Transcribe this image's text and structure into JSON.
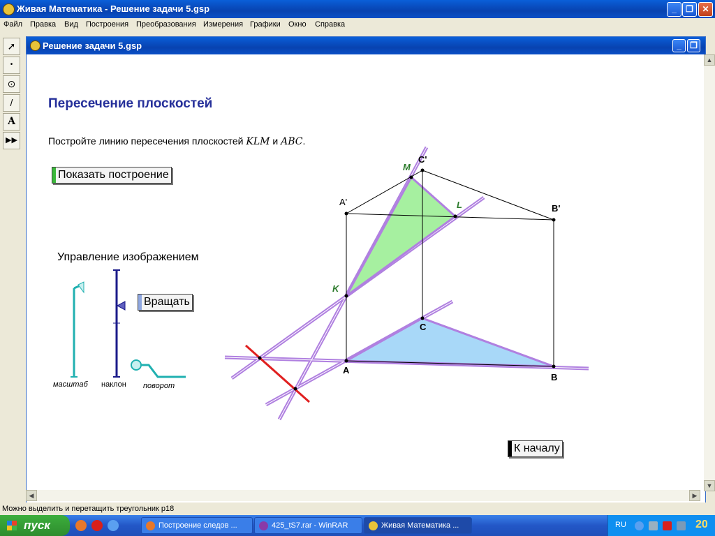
{
  "app": {
    "title": "Живая Математика - Решение задачи 5.gsp",
    "window_buttons": [
      "_",
      "❐",
      "✕"
    ]
  },
  "menu": [
    "Файл",
    "Правка",
    "Вид",
    "Построения",
    "Преобразования",
    "Измерения",
    "Графики",
    "Окно",
    "Справка"
  ],
  "toolbox": [
    {
      "name": "arrow-tool-icon",
      "glyph": "➚"
    },
    {
      "name": "point-tool-icon",
      "glyph": "•"
    },
    {
      "name": "compass-tool-icon",
      "glyph": "⊙"
    },
    {
      "name": "line-tool-icon",
      "glyph": "/"
    },
    {
      "name": "text-tool-icon",
      "glyph": "A"
    },
    {
      "name": "custom-tool-icon",
      "glyph": "▶▶"
    }
  ],
  "document": {
    "title": "Решение задачи 5.gsp",
    "heading": "Пересечение плоскостей",
    "task_prefix": "Постройте линию пересечения плоскостей",
    "task_plane1": "KLM",
    "task_and": "и",
    "task_plane2": "ABC",
    "task_dot": ".",
    "show_button": "Показать построение",
    "control_title": "Управление изображением",
    "rotate_button": "Вращать",
    "back_button": "К началу",
    "slider_labels": {
      "scale": "масштаб",
      "tilt": "наклон",
      "rotation": "поворот"
    },
    "points": {
      "A": "A",
      "B": "B",
      "C": "C",
      "A1": "A'",
      "B1": "B'",
      "C1": "C'",
      "K": "K",
      "L": "L",
      "M": "M"
    },
    "colors": {
      "title": "#26309a",
      "point_label_green": "#2a7a2a",
      "triangle_klm": "#a6f0a0",
      "triangle_abc": "#a8d8f8",
      "trace_lines": "#b080e0",
      "red_line": "#e02020",
      "slider": "#20b0b0",
      "slider_tilt": "#1a1a8a",
      "show_button_mark": "#3ab83a",
      "rotate_button_mark": "#90a8e0",
      "back_button_mark": "#000000"
    }
  },
  "status": "Можно выделить и перетащить треугольник p18",
  "taskbar": {
    "start": "пуск",
    "tasks": [
      {
        "label": "Построение следов ...",
        "active": false
      },
      {
        "label": "425_tS7.rar - WinRAR",
        "active": false
      },
      {
        "label": "Живая Математика ...",
        "active": true
      }
    ],
    "lang": "RU",
    "clock": "20"
  }
}
